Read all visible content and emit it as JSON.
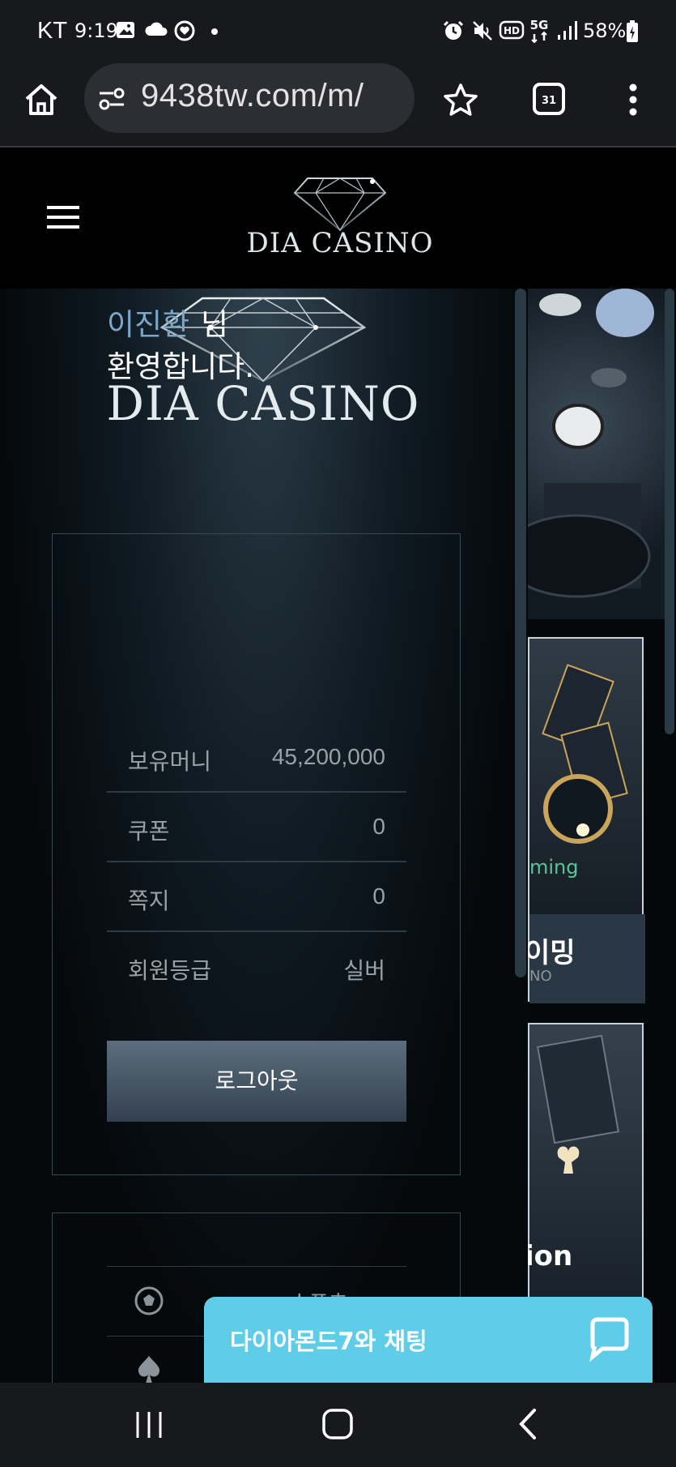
{
  "status_bar": {
    "carrier": "KT",
    "time": "9:19",
    "network": "5G",
    "battery": "58%"
  },
  "browser": {
    "url": "9438tw.com/m/",
    "tab_count": "31"
  },
  "site": {
    "logo_text": "DIA CASINO",
    "hero_logo_text": "DIA CASINO"
  },
  "welcome": {
    "name": "이진환",
    "suffix": "님",
    "line2": "환영합니다."
  },
  "account_info": [
    {
      "label": "보유머니",
      "value": "45,200,000"
    },
    {
      "label": "쿠폰",
      "value": "0"
    },
    {
      "label": "쪽지",
      "value": "0"
    },
    {
      "label": "회원등급",
      "value": "실버"
    }
  ],
  "logout_label": "로그아웃",
  "menu": {
    "first_item_label": "스포츠"
  },
  "side_cards": [
    {
      "label_main": "이밍",
      "label_sub": "NO",
      "brand": "ming"
    },
    {
      "label_main": "ion"
    }
  ],
  "chat": {
    "label": "다이아몬드7와 채팅"
  },
  "colors": {
    "accent_name": "#7aa7c9",
    "chat_bg": "#5fcde8",
    "logout_top": "#5c6d7d",
    "logout_bottom": "#33414f"
  }
}
